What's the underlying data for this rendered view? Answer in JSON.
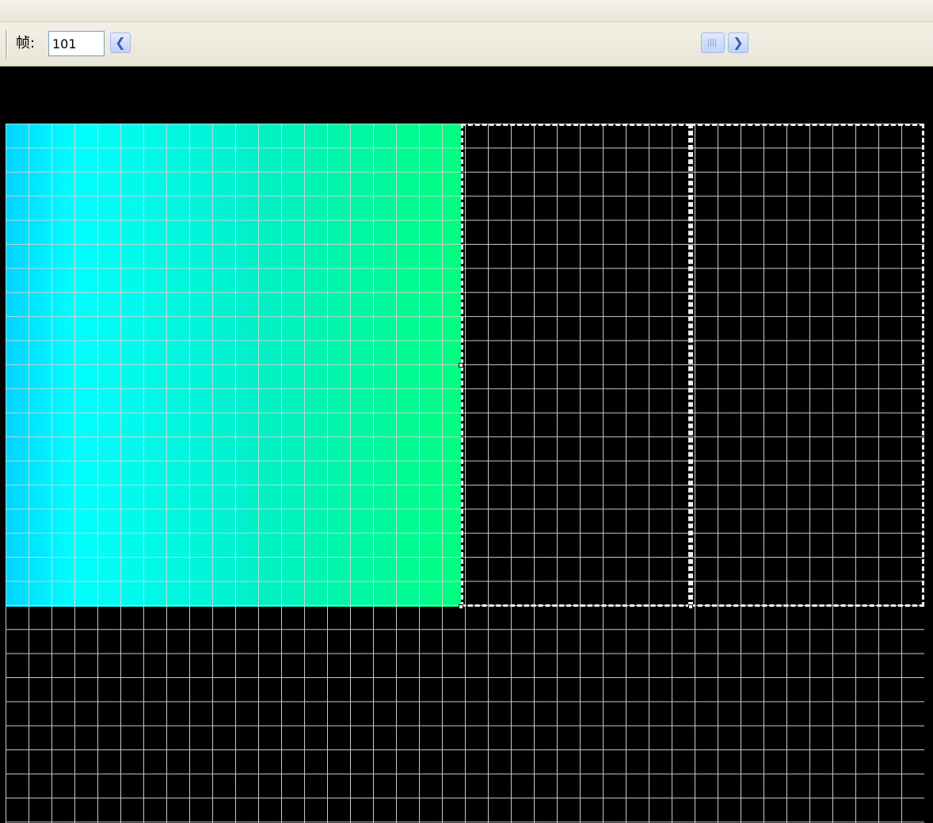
{
  "toolbar": {
    "frame_label": "帧:",
    "frame_value": "101"
  },
  "icons": {
    "scroll_left": "chevron-left-icon",
    "scroll_right": "chevron-right-icon",
    "scroll_thumb": "scroll-thumb-grip"
  },
  "colors": {
    "canvas_background": "#000000",
    "grid_lines": "#c8c8c8",
    "gradient_start": "#00d4ff",
    "gradient_mid": "#00ffff",
    "gradient_end": "#00ff80",
    "selection_border": "#f0f0f0",
    "toolbar_background": "#ece9d8"
  },
  "glyphs": {
    "left": "❮",
    "right": "❯"
  }
}
